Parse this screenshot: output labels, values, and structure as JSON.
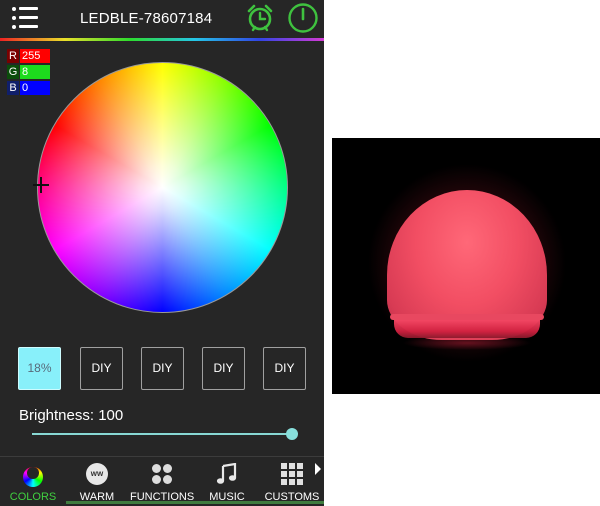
{
  "app": {
    "title": "LEDBLE-78607184",
    "icons": {
      "menu": "menu-list-icon",
      "alarm": "alarm-clock-icon",
      "power": "power-icon"
    }
  },
  "rgb": {
    "r": {
      "label": "R",
      "value": "255"
    },
    "g": {
      "label": "G",
      "value": "8"
    },
    "b": {
      "label": "B",
      "value": "0"
    }
  },
  "presets": [
    {
      "label": "18%",
      "selected": true
    },
    {
      "label": "DIY"
    },
    {
      "label": "DIY"
    },
    {
      "label": "DIY"
    },
    {
      "label": "DIY"
    }
  ],
  "brightness": {
    "label": "Brightness: 100",
    "value": 100
  },
  "nav": {
    "items": [
      {
        "label": "COLORS",
        "icon": "color-wheel-icon",
        "active": true
      },
      {
        "label": "WARM",
        "icon": "warm-ww-icon",
        "icon_text": "ww"
      },
      {
        "label": "FUNCTIONS",
        "icon": "functions-dots-icon"
      },
      {
        "label": "MUSIC",
        "icon": "music-note-icon"
      },
      {
        "label": "CUSTOMS",
        "icon": "customs-grid-icon"
      }
    ],
    "more_icon": "chevron-right-icon"
  },
  "colors": {
    "accent_green": "#40d040",
    "background": "#262626",
    "slider": "#88e0dc",
    "preset_selected": "#88f0fa",
    "bulb": "#f24e63"
  }
}
